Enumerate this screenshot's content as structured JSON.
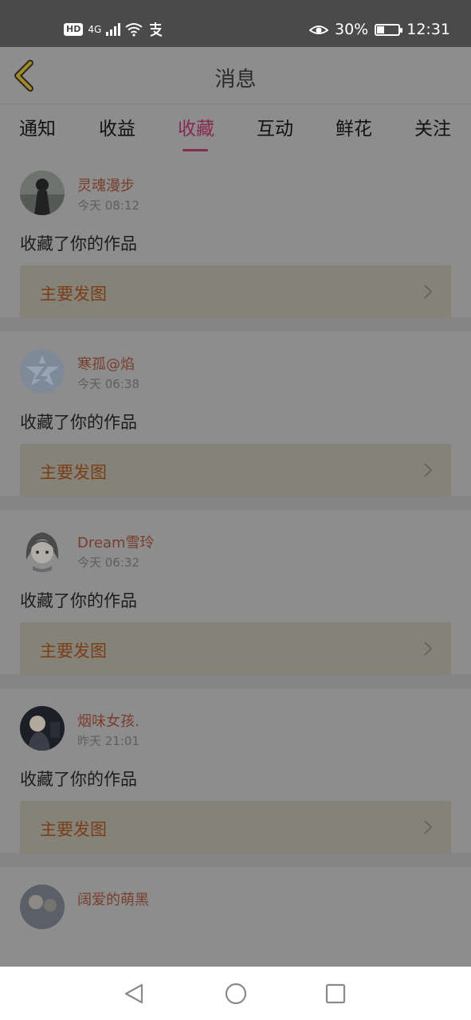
{
  "status_bar": {
    "hd": "HD",
    "network": "4G",
    "right_text": "30%",
    "time": "12:31",
    "battery_level": 0.3
  },
  "header": {
    "title": "消息"
  },
  "tabs": [
    {
      "label": "通知"
    },
    {
      "label": "收益"
    },
    {
      "label": "收藏",
      "active": true
    },
    {
      "label": "互动"
    },
    {
      "label": "鲜花"
    },
    {
      "label": "关注"
    }
  ],
  "items": [
    {
      "name": "灵魂漫步",
      "time": "今天 08:12",
      "action": "收藏了你的作品",
      "work": "主要发图",
      "avatar": "dark-girl-avatar"
    },
    {
      "name": "寒孤@焰",
      "time": "今天 06:38",
      "action": "收藏了你的作品",
      "work": "主要发图",
      "avatar": "default-qq-avatar"
    },
    {
      "name": "Dream雪玲",
      "time": "今天 06:32",
      "action": "收藏了你的作品",
      "work": "主要发图",
      "avatar": "anime-girl-avatar"
    },
    {
      "name": "烟味女孩.",
      "time": "昨天 21:01",
      "action": "收藏了你的作品",
      "work": "主要发图",
      "avatar": "dark-photo-avatar"
    },
    {
      "name": "阔爱的萌黑",
      "time": "",
      "action": "",
      "work": "",
      "avatar": "photo-avatar"
    }
  ],
  "colors": {
    "accent": "#862a4f",
    "username": "#7a3d2b",
    "work_label": "#7a3d18",
    "work_bg": "#858278",
    "status_bar": "#4a4a4a"
  },
  "nav": [
    "back-triangle-icon",
    "home-circle-icon",
    "recents-square-icon"
  ]
}
